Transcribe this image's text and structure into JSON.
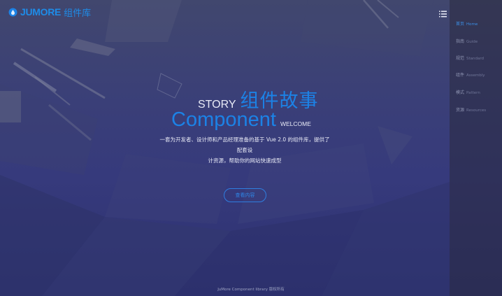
{
  "logo": {
    "brand": "JUMORE",
    "brand_cn": "组件库"
  },
  "nav": {
    "items": [
      {
        "cn": "首页",
        "en": "Home",
        "active": true
      },
      {
        "cn": "指南",
        "en": "Guide",
        "active": false
      },
      {
        "cn": "规范",
        "en": "Standard",
        "active": false
      },
      {
        "cn": "组件",
        "en": "Assembly",
        "active": false
      },
      {
        "cn": "模式",
        "en": "Pattern",
        "active": false
      },
      {
        "cn": "资源",
        "en": "Resources",
        "active": false
      }
    ]
  },
  "hero": {
    "story": "STORY",
    "title_cn": "组件故事",
    "component": "Component",
    "welcome": "WELCOME",
    "description_line1": "一套为开发者、设计师和产品经理准备的基于 Vue 2.0 的组件库，提供了配套设",
    "description_line2": "计资源，帮助你的网站快速成型",
    "cta_label": "查看内容"
  },
  "footer": {
    "text": "JuMore Component library 版权所有"
  },
  "colors": {
    "accent": "#1c82e6",
    "sidebar_bg": "#2a2a3e",
    "hero_bg": "#363a7c"
  }
}
